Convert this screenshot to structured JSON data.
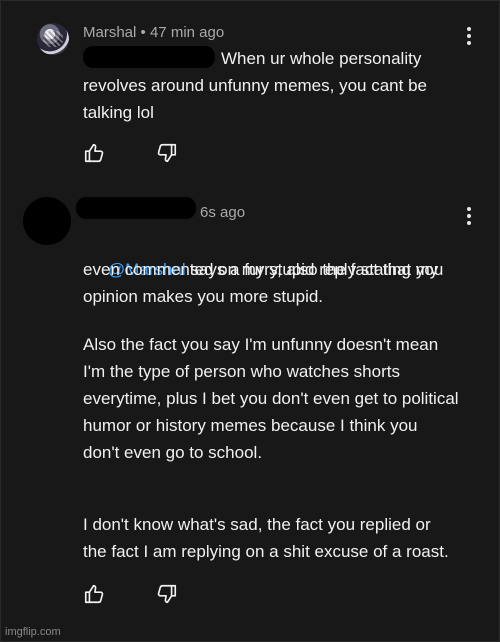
{
  "comment1": {
    "author": "Marshal",
    "separator": "•",
    "time": "47 min ago",
    "text_lines": [
      "When ur whole personality",
      "revolves around unfunny memes, you cant be",
      "talking lol"
    ],
    "like_icon": "thumbs-up-icon",
    "dislike_icon": "thumbs-down-icon",
    "more_icon": "more-vertical-icon"
  },
  "comment2": {
    "time": "6s ago",
    "mention": "@Marshal",
    "line1_rest": "says a furry, also the fact that you",
    "text_lines": [
      "even commented on my stupid reply stating my",
      "opinion makes you more stupid.",
      "",
      "Also the fact you say I'm unfunny doesn't mean",
      "I'm the type of person who watches shorts",
      "everytime, plus I bet you don't even get to political",
      "humor or history memes because I think you",
      "don't even go to school.",
      "",
      "",
      "I don't know what's sad, the fact you replied or",
      "the fact I am replying on a shit excuse of a roast."
    ],
    "like_icon": "thumbs-up-icon",
    "dislike_icon": "thumbs-down-icon",
    "more_icon": "more-vertical-icon"
  },
  "watermark": "imgflip.com",
  "colors": {
    "background": "#181818",
    "text": "#f1f1f1",
    "meta": "#aaaaaa",
    "mention": "#3ea6ff"
  }
}
